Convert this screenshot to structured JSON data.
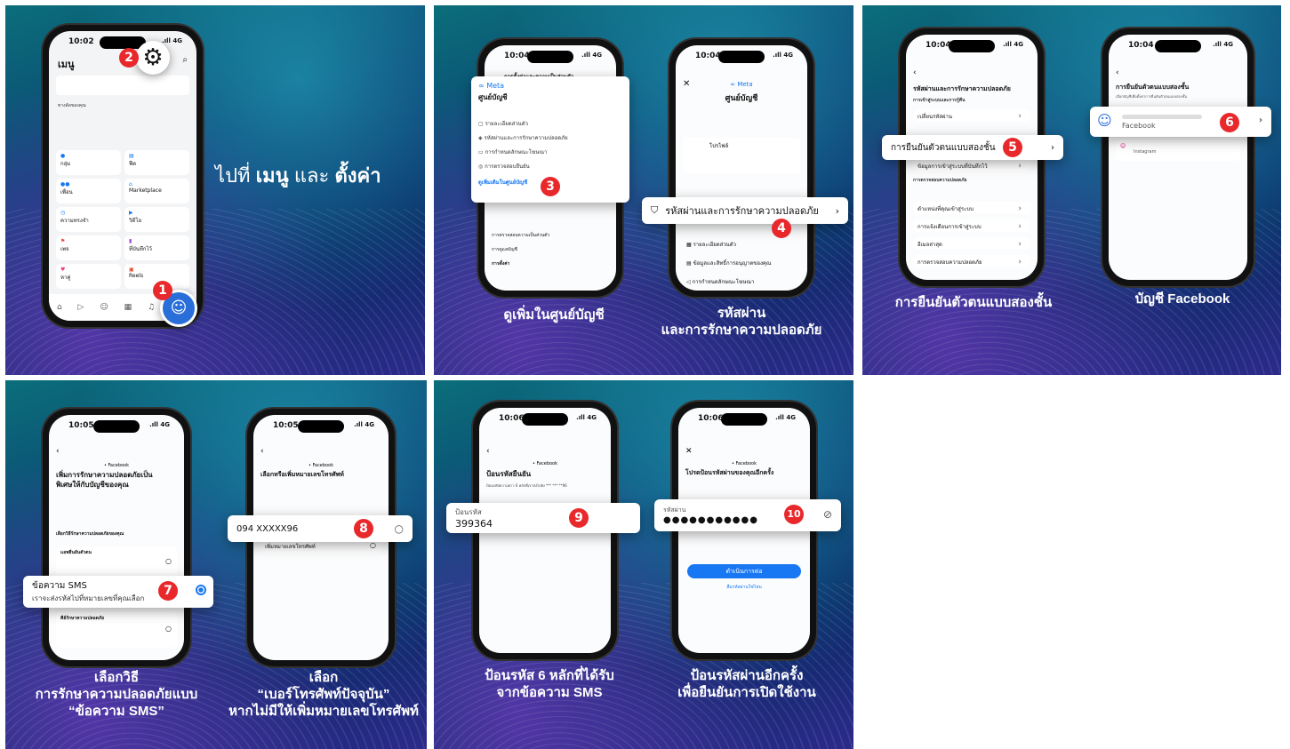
{
  "phone": {
    "signal": ".ıll 4G"
  },
  "p1": {
    "time": "10:02",
    "title": "เมนู",
    "caption_pre": "ไปที่",
    "caption_menu": "เมนู",
    "caption_and": "และ",
    "caption_settings": "ตั้งค่า",
    "shortcut_label": "ทางลัดของคุณ",
    "tiles": [
      "กลุ่ม",
      "ฟีด",
      "เพื่อน",
      "Marketplace",
      "ความทรงจำ",
      "วิดีโอ",
      "เพจ",
      "ที่บันทึกไว้",
      "หาคู่",
      "Reels"
    ],
    "badge1": "1",
    "badge2": "2"
  },
  "p2": {
    "time": "10:04",
    "header": "การตั้งค่าและความเป็นส่วนตัว",
    "meta": "Meta",
    "ac_title": "ศูนย์บัญชี",
    "ac_items": [
      "รายละเอียดส่วนตัว",
      "รหัสผ่านและการรักษาความปลอดภัย",
      "การกำหนดลักษณะโฆษณา",
      "การตรวจสอบยืนยัน"
    ],
    "see_more": "ดูเพิ่มเติมในศูนย์บัญชี",
    "below_items": [
      "การตรวจสอบความเป็นส่วนตัว",
      "การดูแลบัญชี",
      "การตั้งค่า"
    ],
    "caption": "ดูเพิ่มในศูนย์บัญชี",
    "badge": "3"
  },
  "p3": {
    "time": "10:04",
    "meta": "Meta",
    "title": "ศูนย์บัญชี",
    "profiles": "โปรไฟล์",
    "callout": "รหัสผ่านและการรักษาความปลอดภัย",
    "items": [
      "รายละเอียดส่วนตัว",
      "ข้อมูลและสิทธิ์การอนุญาตของคุณ",
      "การกำหนดลักษณะโฆษณา"
    ],
    "caption_l1": "รหัสผ่าน",
    "caption_l2": "และการรักษาความปลอดภัย",
    "badge": "4"
  },
  "p4": {
    "time": "10:04",
    "title": "รหัสผ่านและการรักษาความปลอดภัย",
    "sub": "การเข้าสู่ระบบและการกู้คืน",
    "callout": "การยืนยันตัวตนแบบสองชั้น",
    "items": [
      "เปลี่ยนรหัสผ่าน",
      "ข้อมูลการเข้าสู่ระบบที่บันทึกไว้",
      "การตรวจสอบความปลอดภัย",
      "ตำแหน่งที่คุณเข้าสู่ระบบ",
      "การแจ้งเตือนการเข้าสู่ระบบ",
      "อีเมลล่าสุด",
      "การตรวจสอบความปลอดภัย"
    ],
    "caption": "การยืนยันตัวตนแบบสองชั้น",
    "badge": "5"
  },
  "p5": {
    "time": "10:04",
    "title": "การยืนยันตัวตนแบบสองชั้น",
    "sub": "เลือกบัญชีเพื่อตั้งค่าการยืนยันตัวตนแบบสองชั้น",
    "account1": "Facebook",
    "account2": "Instagram",
    "caption": "บัญชี Facebook",
    "badge": "6"
  },
  "p6": {
    "time": "10:05",
    "brand": "• Facebook",
    "title_l1": "เพิ่มการรักษาความปลอดภัยเป็น",
    "title_l2": "พิเศษให้กับบัญชีของคุณ",
    "section": "เลือกวิธีรักษาความปลอดภัยของคุณ",
    "opt1": "แอพยืนยันตัวตน",
    "callout_l1": "ข้อความ SMS",
    "callout_l2": "เราจะส่งรหัสไปที่หมายเลขที่คุณเลือก",
    "opt3": "คีย์รักษาความปลอดภัย",
    "caption_l1": "เลือกวิธี",
    "caption_l2": "การรักษาความปลอดภัยแบบ",
    "caption_l3": "“ข้อความ SMS”",
    "badge": "7"
  },
  "p7": {
    "time": "10:05",
    "brand": "• Facebook",
    "title": "เลือกหรือเพิ่มหมายเลขโทรศัพท์",
    "phone_number": "094 XXXXX96",
    "add_number": "เพิ่มหมายเลขโทรศัพท์",
    "caption_l1": "เลือก",
    "caption_l2": "“เบอร์โทรศัพท์ปัจจุบัน”",
    "caption_l3": "หากไม่มีให้เพิ่มหมายเลขโทรศัพท์",
    "badge": "8"
  },
  "p8": {
    "time": "10:06",
    "brand": "• Facebook",
    "title": "ป้อนรหัสยืนยัน",
    "sub": "ป้อนรหัสความยาว 6 หลักที่เราส่งไปยัง *** *** **96",
    "field_label": "ป้อนรหัส",
    "code": "399364",
    "caption_l1": "ป้อนรหัส 6 หลักที่ได้รับ",
    "caption_l2": "จากข้อความ SMS",
    "badge": "9"
  },
  "p9": {
    "time": "10:06",
    "brand": "• Facebook",
    "title": "โปรดป้อนรหัสผ่านของคุณอีกครั้ง",
    "field_label": "รหัสผ่าน",
    "password": "●●●●●●●●●●●",
    "continue": "ดำเนินการต่อ",
    "forgot": "ลืมรหัสผ่านใช่ไหม",
    "caption_l1": "ป้อนรหัสผ่านอีกครั้ง",
    "caption_l2": "เพื่อยืนยันการเปิดใช้งาน",
    "badge": "10"
  }
}
